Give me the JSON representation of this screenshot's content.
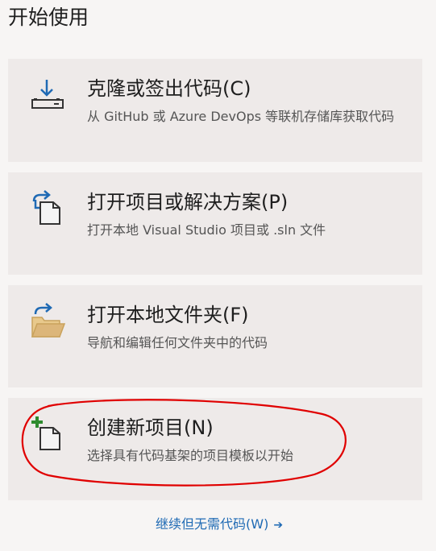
{
  "header": {
    "title": "开始使用"
  },
  "cards": [
    {
      "title": "克隆或签出代码(C)",
      "description": "从 GitHub 或 Azure DevOps 等联机存储库获取代码",
      "icon": "clone-download-icon"
    },
    {
      "title": "打开项目或解决方案(P)",
      "description": "打开本地 Visual Studio 项目或 .sln 文件",
      "icon": "open-project-icon"
    },
    {
      "title": "打开本地文件夹(F)",
      "description": "导航和编辑任何文件夹中的代码",
      "icon": "open-folder-icon"
    },
    {
      "title": "创建新项目(N)",
      "description": "选择具有代码基架的项目模板以开始",
      "icon": "new-project-icon"
    }
  ],
  "footer": {
    "continue_label": "继续但无需代码(W)",
    "continue_arrow": "➔"
  },
  "colors": {
    "background": "#f7f5f4",
    "card": "#eeeae9",
    "link": "#1f6ab4",
    "icon_blue": "#1f6ab4",
    "icon_green": "#2e8b2e",
    "folder": "#dcb67a",
    "annotation": "#e00000"
  }
}
